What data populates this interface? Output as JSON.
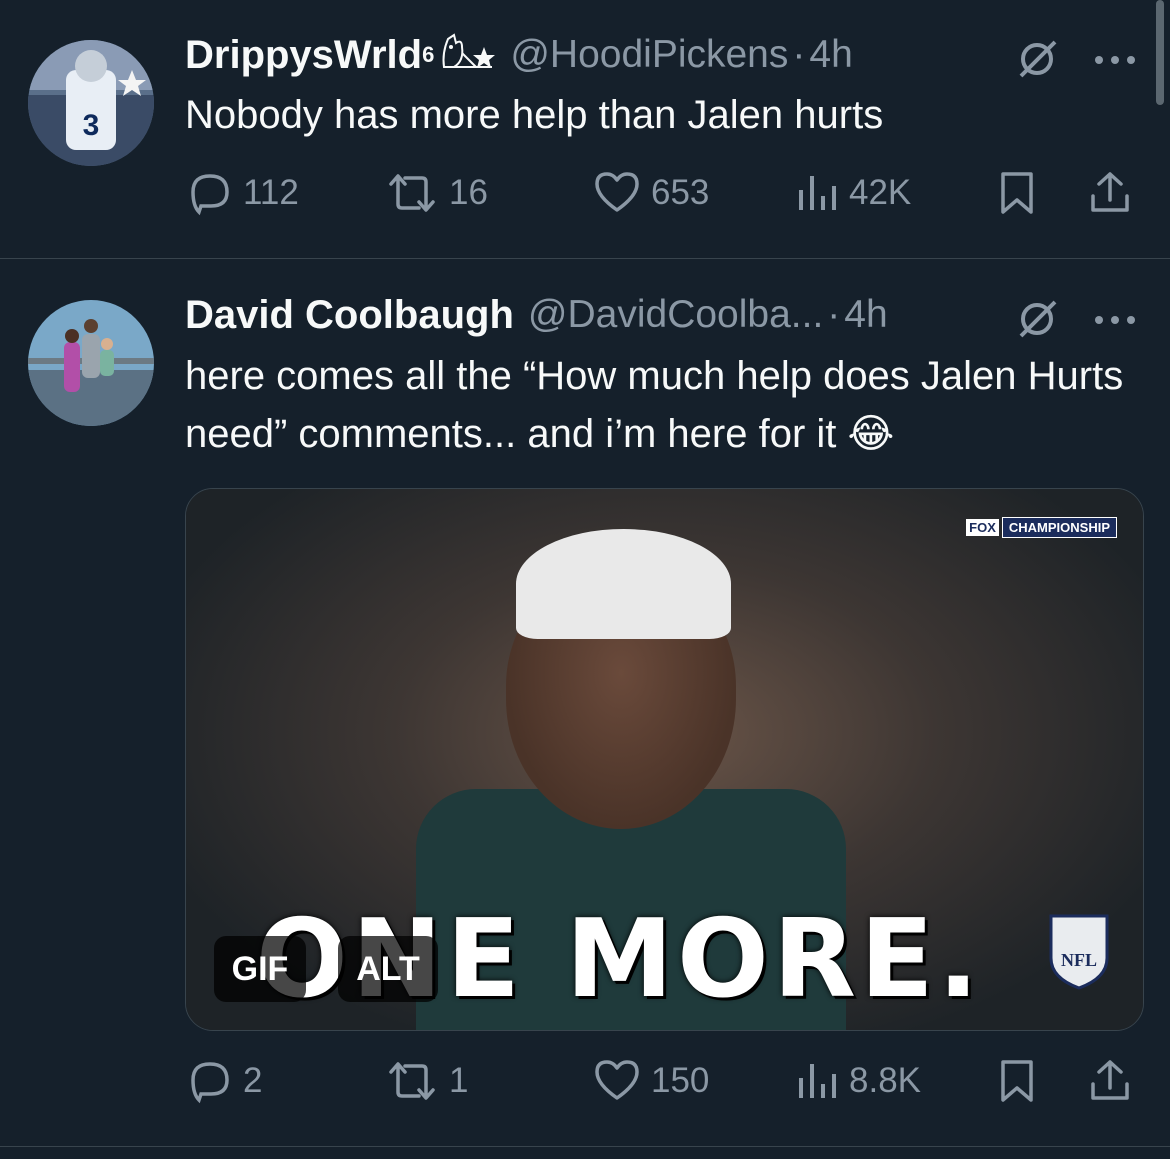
{
  "tweets": [
    {
      "display_name": "DrippysWrld",
      "superscript": "6",
      "name_emoji": "🦉★",
      "handle": "@HoodiPickens",
      "separator": "·",
      "time": "4h",
      "text": "Nobody has more help than Jalen hurts",
      "replies": "112",
      "retweets": "16",
      "likes": "653",
      "views": "42K"
    },
    {
      "display_name": "David Coolbaugh",
      "handle": "@DavidCoolba...",
      "separator": "·",
      "time": "4h",
      "text": "here comes all the “How much help does Jalen Hurts need” comments... and i’m here for it 😂",
      "media": {
        "overlay_text": "ONE MORE.",
        "gif_label": "GIF",
        "alt_label": "ALT",
        "fox_label": "FOX",
        "championship_label": "CHAMPIONSHIP"
      },
      "replies": "2",
      "retweets": "1",
      "likes": "150",
      "views": "8.8K"
    }
  ],
  "colors": {
    "background": "#15202b",
    "text_primary": "#f7f9f9",
    "text_secondary": "#8b98a5",
    "divider": "#38444d"
  },
  "icons": [
    "reply-icon",
    "retweet-icon",
    "like-icon",
    "views-icon",
    "bookmark-icon",
    "share-icon",
    "grok-icon",
    "more-icon"
  ]
}
